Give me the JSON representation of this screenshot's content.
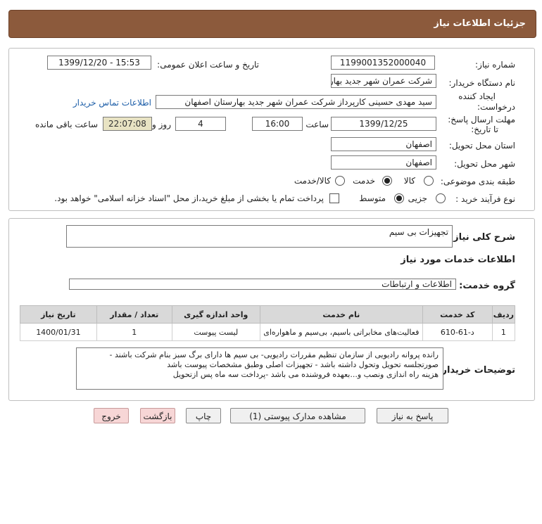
{
  "header": {
    "title": "جزئیات اطلاعات نیاز"
  },
  "watermark": {
    "digits": "010101",
    "brand": "ParsNamadData"
  },
  "info": {
    "need_number_label": "شماره نیاز:",
    "need_number": "1199001352000040",
    "announce_label": "تاریخ و ساعت اعلان عمومی:",
    "announce_value": "1399/12/20 - 15:53",
    "buyer_label": "نام دستگاه خریدار:",
    "buyer_value": "شرکت عمران شهر جدید بهارستان اصفهان",
    "creator_label_1": "ایجاد کننده",
    "creator_label_2": "درخواست:",
    "creator_value": "سید مهدی حسینی کارپرداز شرکت عمران شهر جدید بهارستان اصفهان",
    "contact_link": "اطلاعات تماس خریدار",
    "deadline_label_1": "مهلت ارسال پاسخ:",
    "deadline_label_2": "تا تاریخ:",
    "deadline_date": "1399/12/25",
    "time_label": "ساعت",
    "deadline_time": "16:00",
    "days_value": "4",
    "days_label": "روز و",
    "remaining_time": "22:07:08",
    "remaining_label": "ساعت باقی مانده",
    "province_label": "استان محل تحویل:",
    "province_value": "اصفهان",
    "city_label": "شهر محل تحویل:",
    "city_value": "اصفهان",
    "category_label": "طبقه بندی موضوعی:",
    "category_options": [
      "کالا",
      "خدمت",
      "کالا/خدمت"
    ],
    "category_selected": "خدمت",
    "process_label": "نوع فرآیند خرید :",
    "process_options": [
      "جزیی",
      "متوسط"
    ],
    "process_selected": "متوسط",
    "payment_note": "پرداخت تمام یا بخشی از مبلغ خرید،از محل \"اسناد خزانه اسلامی\" خواهد بود."
  },
  "details": {
    "general_desc_label": "شرح کلی نیاز:",
    "general_desc_value": "تجهیزات بی سیم",
    "services_info_title": "اطلاعات خدمات مورد نیاز",
    "service_group_label": "گروه خدمت:",
    "service_group_value": "اطلاعات و ارتباطات",
    "table": {
      "headers": [
        "ردیف",
        "کد خدمت",
        "نام خدمت",
        "واحد اندازه گیری",
        "تعداد / مقدار",
        "تاریخ نیاز"
      ],
      "rows": [
        [
          "1",
          "د-61-610",
          "فعالیت‌های مخابراتی باسیم، بی‌سیم و ماهواره‌ای",
          "لیست پیوست",
          "1",
          "1400/01/31"
        ]
      ]
    },
    "buyer_notes_label": "توضیحات خریدار:",
    "buyer_notes_lines": [
      "رانده پروانه رادیویی از سازمان تنظیم مقررات رادیویی- بی سیم ها دارای برگ سبز بنام شرکت باشند -",
      "صورتجلسه تحویل وتحول داشته باشد - تجهیزات اصلی وطبق مشخصات پیوست باشد",
      "هزینه راه اندازی ونصب و...بعهده فروشنده می باشد -پرداخت سه ماه پس ازتحویل"
    ]
  },
  "buttons": {
    "reply": "پاسخ به نیاز",
    "attachments": "مشاهده مدارک پیوستی (1)",
    "print": "چاپ",
    "back": "بازگشت",
    "exit": "خروج"
  }
}
